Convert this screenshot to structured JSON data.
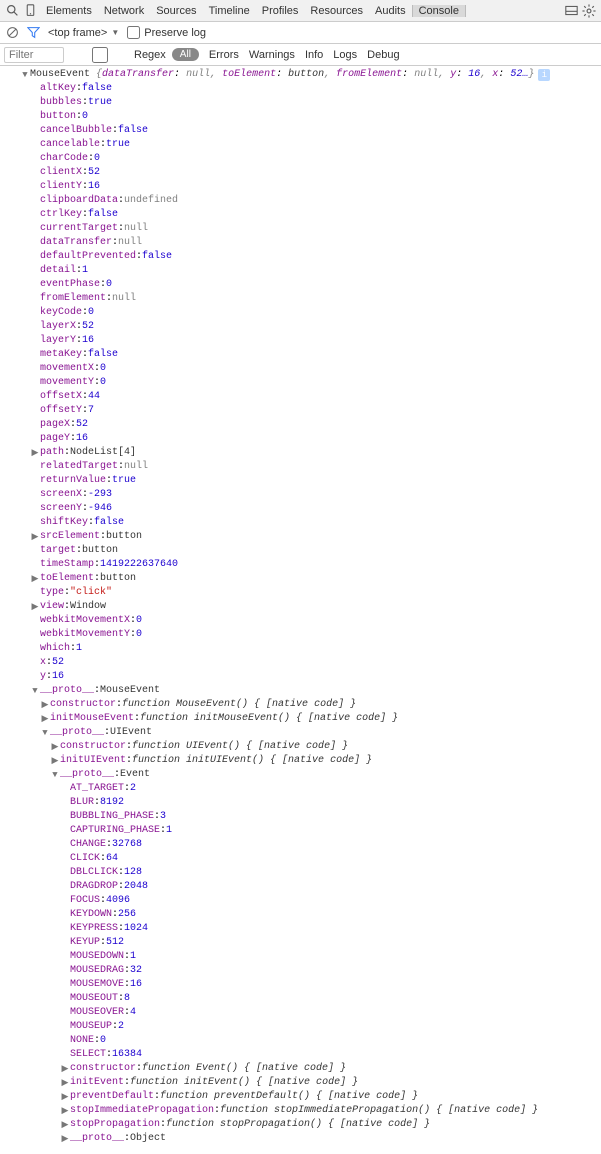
{
  "tabs": [
    "Elements",
    "Network",
    "Sources",
    "Timeline",
    "Profiles",
    "Resources",
    "Audits",
    "Console"
  ],
  "activeTab": "Console",
  "toolbar": {
    "frame": "<top frame>",
    "preserve": "Preserve log"
  },
  "filter": {
    "placeholder": "Filter",
    "regex": "Regex",
    "all": "All",
    "links": [
      "Errors",
      "Warnings",
      "Info",
      "Logs",
      "Debug"
    ]
  },
  "header": {
    "cls": "MouseEvent",
    "summary": [
      {
        "k": "dataTransfer",
        "t": "nul",
        "v": "null"
      },
      {
        "k": "toElement",
        "t": "obj",
        "v": "button"
      },
      {
        "k": "fromElement",
        "t": "nul",
        "v": "null"
      },
      {
        "k": "y",
        "t": "num",
        "v": "16"
      },
      {
        "k": "x",
        "t": "num",
        "v": "52…"
      }
    ],
    "badge": "i"
  },
  "props": [
    {
      "ind": 40,
      "k": "altKey",
      "t": "bool",
      "v": "false"
    },
    {
      "ind": 40,
      "k": "bubbles",
      "t": "bool",
      "v": "true"
    },
    {
      "ind": 40,
      "k": "button",
      "t": "num",
      "v": "0"
    },
    {
      "ind": 40,
      "k": "cancelBubble",
      "t": "bool",
      "v": "false"
    },
    {
      "ind": 40,
      "k": "cancelable",
      "t": "bool",
      "v": "true"
    },
    {
      "ind": 40,
      "k": "charCode",
      "t": "num",
      "v": "0"
    },
    {
      "ind": 40,
      "k": "clientX",
      "t": "num",
      "v": "52"
    },
    {
      "ind": 40,
      "k": "clientY",
      "t": "num",
      "v": "16"
    },
    {
      "ind": 40,
      "k": "clipboardData",
      "t": "nul",
      "v": "undefined"
    },
    {
      "ind": 40,
      "k": "ctrlKey",
      "t": "bool",
      "v": "false"
    },
    {
      "ind": 40,
      "k": "currentTarget",
      "t": "nul",
      "v": "null"
    },
    {
      "ind": 40,
      "k": "dataTransfer",
      "t": "nul",
      "v": "null"
    },
    {
      "ind": 40,
      "k": "defaultPrevented",
      "t": "bool",
      "v": "false"
    },
    {
      "ind": 40,
      "k": "detail",
      "t": "num",
      "v": "1"
    },
    {
      "ind": 40,
      "k": "eventPhase",
      "t": "num",
      "v": "0"
    },
    {
      "ind": 40,
      "k": "fromElement",
      "t": "nul",
      "v": "null"
    },
    {
      "ind": 40,
      "k": "keyCode",
      "t": "num",
      "v": "0"
    },
    {
      "ind": 40,
      "k": "layerX",
      "t": "num",
      "v": "52"
    },
    {
      "ind": 40,
      "k": "layerY",
      "t": "num",
      "v": "16"
    },
    {
      "ind": 40,
      "k": "metaKey",
      "t": "bool",
      "v": "false"
    },
    {
      "ind": 40,
      "k": "movementX",
      "t": "num",
      "v": "0"
    },
    {
      "ind": 40,
      "k": "movementY",
      "t": "num",
      "v": "0"
    },
    {
      "ind": 40,
      "k": "offsetX",
      "t": "num",
      "v": "44"
    },
    {
      "ind": 40,
      "k": "offsetY",
      "t": "num",
      "v": "7"
    },
    {
      "ind": 40,
      "k": "pageX",
      "t": "num",
      "v": "52"
    },
    {
      "ind": 40,
      "k": "pageY",
      "t": "num",
      "v": "16"
    },
    {
      "ind": 30,
      "arr": "r",
      "k": "path",
      "t": "obj",
      "v": "NodeList[4]"
    },
    {
      "ind": 40,
      "k": "relatedTarget",
      "t": "nul",
      "v": "null"
    },
    {
      "ind": 40,
      "k": "returnValue",
      "t": "bool",
      "v": "true"
    },
    {
      "ind": 40,
      "k": "screenX",
      "t": "num",
      "v": "-293"
    },
    {
      "ind": 40,
      "k": "screenY",
      "t": "num",
      "v": "-946"
    },
    {
      "ind": 40,
      "k": "shiftKey",
      "t": "bool",
      "v": "false"
    },
    {
      "ind": 30,
      "arr": "r",
      "k": "srcElement",
      "t": "obj",
      "v": "button"
    },
    {
      "ind": 40,
      "k": "target",
      "t": "obj",
      "v": "button"
    },
    {
      "ind": 40,
      "k": "timeStamp",
      "t": "num",
      "v": "1419222637640"
    },
    {
      "ind": 30,
      "arr": "r",
      "k": "toElement",
      "t": "obj",
      "v": "button"
    },
    {
      "ind": 40,
      "k": "type",
      "t": "str",
      "v": "\"click\""
    },
    {
      "ind": 30,
      "arr": "r",
      "k": "view",
      "t": "obj",
      "v": "Window"
    },
    {
      "ind": 40,
      "k": "webkitMovementX",
      "t": "num",
      "v": "0"
    },
    {
      "ind": 40,
      "k": "webkitMovementY",
      "t": "num",
      "v": "0"
    },
    {
      "ind": 40,
      "k": "which",
      "t": "num",
      "v": "1"
    },
    {
      "ind": 40,
      "k": "x",
      "t": "num",
      "v": "52"
    },
    {
      "ind": 40,
      "k": "y",
      "t": "num",
      "v": "16"
    },
    {
      "ind": 30,
      "arr": "d",
      "k": "__proto__",
      "t": "obj",
      "v": "MouseEvent"
    },
    {
      "ind": 40,
      "arr": "r",
      "k": "constructor",
      "t": "fn",
      "v": "function MouseEvent() { [native code] }"
    },
    {
      "ind": 40,
      "arr": "r",
      "k": "initMouseEvent",
      "t": "fn",
      "v": "function initMouseEvent() { [native code] }"
    },
    {
      "ind": 40,
      "arr": "d",
      "k": "__proto__",
      "t": "obj",
      "v": "UIEvent"
    },
    {
      "ind": 50,
      "arr": "r",
      "k": "constructor",
      "t": "fn",
      "v": "function UIEvent() { [native code] }"
    },
    {
      "ind": 50,
      "arr": "r",
      "k": "initUIEvent",
      "t": "fn",
      "v": "function initUIEvent() { [native code] }"
    },
    {
      "ind": 50,
      "arr": "d",
      "k": "__proto__",
      "t": "obj",
      "v": "Event"
    },
    {
      "ind": 70,
      "k": "AT_TARGET",
      "t": "num",
      "v": "2"
    },
    {
      "ind": 70,
      "k": "BLUR",
      "t": "num",
      "v": "8192"
    },
    {
      "ind": 70,
      "k": "BUBBLING_PHASE",
      "t": "num",
      "v": "3"
    },
    {
      "ind": 70,
      "k": "CAPTURING_PHASE",
      "t": "num",
      "v": "1"
    },
    {
      "ind": 70,
      "k": "CHANGE",
      "t": "num",
      "v": "32768"
    },
    {
      "ind": 70,
      "k": "CLICK",
      "t": "num",
      "v": "64"
    },
    {
      "ind": 70,
      "k": "DBLCLICK",
      "t": "num",
      "v": "128"
    },
    {
      "ind": 70,
      "k": "DRAGDROP",
      "t": "num",
      "v": "2048"
    },
    {
      "ind": 70,
      "k": "FOCUS",
      "t": "num",
      "v": "4096"
    },
    {
      "ind": 70,
      "k": "KEYDOWN",
      "t": "num",
      "v": "256"
    },
    {
      "ind": 70,
      "k": "KEYPRESS",
      "t": "num",
      "v": "1024"
    },
    {
      "ind": 70,
      "k": "KEYUP",
      "t": "num",
      "v": "512"
    },
    {
      "ind": 70,
      "k": "MOUSEDOWN",
      "t": "num",
      "v": "1"
    },
    {
      "ind": 70,
      "k": "MOUSEDRAG",
      "t": "num",
      "v": "32"
    },
    {
      "ind": 70,
      "k": "MOUSEMOVE",
      "t": "num",
      "v": "16"
    },
    {
      "ind": 70,
      "k": "MOUSEOUT",
      "t": "num",
      "v": "8"
    },
    {
      "ind": 70,
      "k": "MOUSEOVER",
      "t": "num",
      "v": "4"
    },
    {
      "ind": 70,
      "k": "MOUSEUP",
      "t": "num",
      "v": "2"
    },
    {
      "ind": 70,
      "k": "NONE",
      "t": "num",
      "v": "0"
    },
    {
      "ind": 70,
      "k": "SELECT",
      "t": "num",
      "v": "16384"
    },
    {
      "ind": 60,
      "arr": "r",
      "k": "constructor",
      "t": "fn",
      "v": "function Event() { [native code] }"
    },
    {
      "ind": 60,
      "arr": "r",
      "k": "initEvent",
      "t": "fn",
      "v": "function initEvent() { [native code] }"
    },
    {
      "ind": 60,
      "arr": "r",
      "k": "preventDefault",
      "t": "fn",
      "v": "function preventDefault() { [native code] }"
    },
    {
      "ind": 60,
      "arr": "r",
      "k": "stopImmediatePropagation",
      "t": "fn",
      "v": "function stopImmediatePropagation() { [native code] }"
    },
    {
      "ind": 60,
      "arr": "r",
      "k": "stopPropagation",
      "t": "fn",
      "v": "function stopPropagation() { [native code] }"
    },
    {
      "ind": 60,
      "arr": "r",
      "k": "__proto__",
      "t": "obj",
      "v": "Object"
    }
  ]
}
